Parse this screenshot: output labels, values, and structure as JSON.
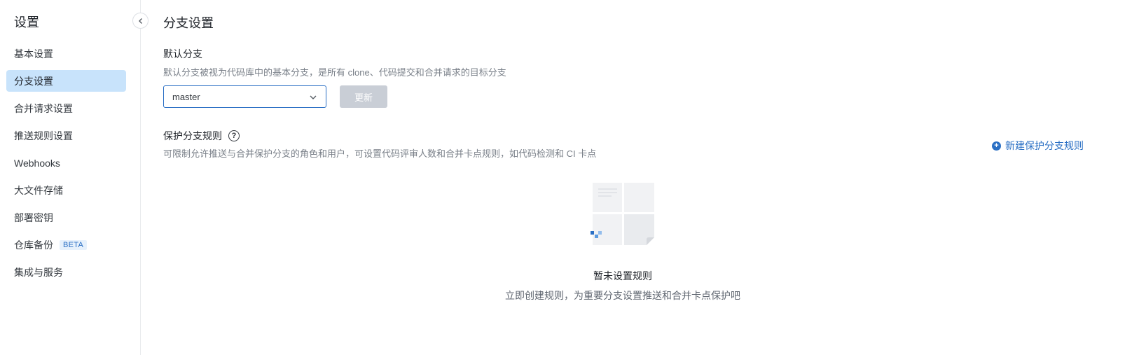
{
  "sidebar": {
    "title": "设置",
    "items": [
      {
        "label": "基本设置"
      },
      {
        "label": "分支设置",
        "active": true
      },
      {
        "label": "合并请求设置"
      },
      {
        "label": "推送规则设置"
      },
      {
        "label": "Webhooks"
      },
      {
        "label": "大文件存储"
      },
      {
        "label": "部署密钥"
      },
      {
        "label": "仓库备份",
        "badge": "BETA"
      },
      {
        "label": "集成与服务"
      }
    ]
  },
  "main": {
    "title": "分支设置",
    "default_branch": {
      "title": "默认分支",
      "description": "默认分支被视为代码库中的基本分支，是所有 clone、代码提交和合并请求的目标分支",
      "selected_value": "master",
      "update_label": "更新"
    },
    "protect_rules": {
      "title": "保护分支规则",
      "help_icon": "question-circle-icon",
      "description": "可限制允许推送与合并保护分支的角色和用户，可设置代码评审人数和合并卡点规则，如代码检测和 CI 卡点",
      "new_rule_label": "新建保护分支规则",
      "empty_title": "暂未设置规则",
      "empty_desc": "立即创建规则，为重要分支设置推送和合并卡点保护吧"
    }
  },
  "colors": {
    "accent": "#2a6fc4",
    "active_bg": "#c8e3fb",
    "disabled_button": "#c9ced6"
  }
}
